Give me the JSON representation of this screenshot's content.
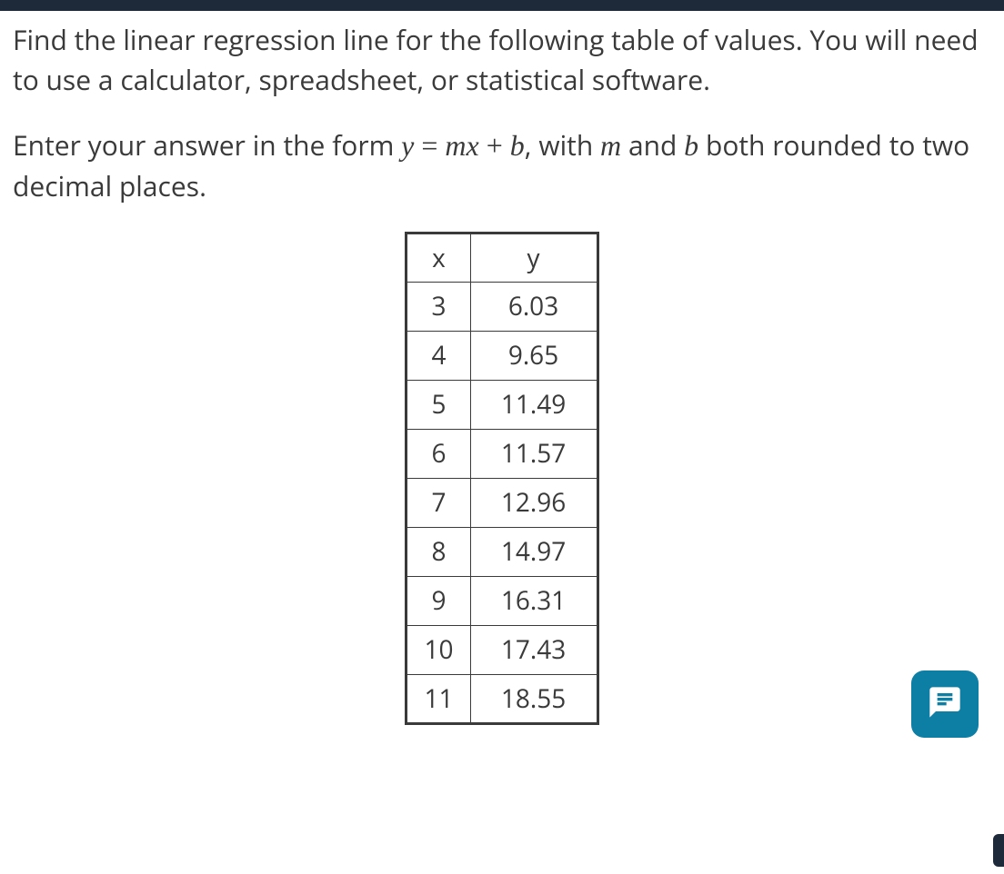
{
  "question": {
    "paragraph1": "Find the linear regression line for the following table of values. You will need to use a calculator, spreadsheet, or statistical software.",
    "paragraph2_pre": "Enter your answer in the form ",
    "equation_y": "y",
    "equation_eq": " = ",
    "equation_mx": "mx",
    "equation_plus": " + ",
    "equation_b": "b",
    "paragraph2_mid": ", with ",
    "equation_m": "m",
    "paragraph2_and": " and ",
    "equation_b2": "b",
    "paragraph2_post": " both rounded to two decimal places."
  },
  "chart_data": {
    "type": "table",
    "headers": {
      "x": "x",
      "y": "y"
    },
    "rows": [
      {
        "x": "3",
        "y": "6.03"
      },
      {
        "x": "4",
        "y": "9.65"
      },
      {
        "x": "5",
        "y": "11.49"
      },
      {
        "x": "6",
        "y": "11.57"
      },
      {
        "x": "7",
        "y": "12.96"
      },
      {
        "x": "8",
        "y": "14.97"
      },
      {
        "x": "9",
        "y": "16.31"
      },
      {
        "x": "10",
        "y": "17.43"
      },
      {
        "x": "11",
        "y": "18.55"
      }
    ]
  },
  "chat": {
    "icon_name": "chat-icon"
  }
}
